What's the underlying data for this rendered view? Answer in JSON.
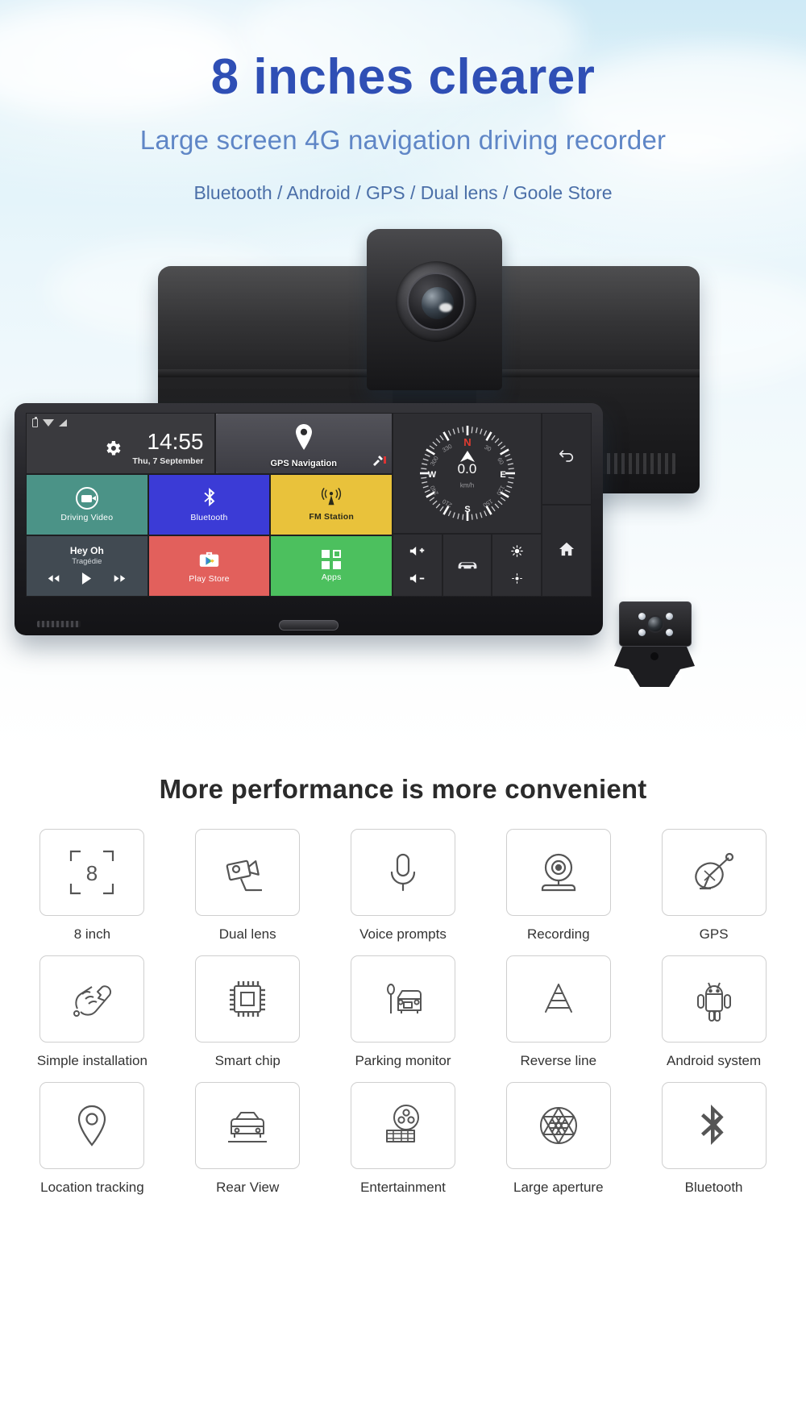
{
  "hero": {
    "title": "8 inches clearer",
    "subtitle": "Large screen 4G navigation driving recorder",
    "features_line": "Bluetooth / Android / GPS / Dual lens / Goole Store"
  },
  "device_screen": {
    "status_bar": {
      "battery_icon": "battery-icon",
      "wifi_icon": "wifi-icon",
      "signal_icon": "signal-icon"
    },
    "clock": {
      "time": "14:55",
      "date": "Thu, 7 September"
    },
    "settings_icon": "gear-icon",
    "map_tile": {
      "label": "GPS Navigation",
      "pin_icon": "map-pin-icon",
      "satellite_icon": "satellite-icon"
    },
    "tiles": [
      {
        "label": "Driving Video",
        "icon": "video-camera-icon",
        "color": "#4b9387"
      },
      {
        "label": "Bluetooth",
        "icon": "bluetooth-icon",
        "color": "#3b3bd6"
      },
      {
        "label": "FM Station",
        "icon": "radio-tower-icon",
        "color": "#e9c23b"
      },
      {
        "label": "Play Store",
        "icon": "play-store-icon",
        "color": "#e2605c"
      },
      {
        "label": "Apps",
        "icon": "apps-grid-icon",
        "color": "#4cc05e"
      }
    ],
    "music_player": {
      "track_title": "Hey Oh",
      "artist": "Tragédie",
      "prev_icon": "previous-track-icon",
      "play_icon": "play-icon",
      "next_icon": "next-track-icon"
    },
    "compass": {
      "north": "N",
      "east": "E",
      "south": "S",
      "west": "W",
      "ticks": [
        "30",
        "60",
        "120",
        "150",
        "210",
        "240",
        "300",
        "330"
      ],
      "speed_value": "0.0",
      "speed_unit": "km/h",
      "needle_icon": "compass-needle-icon"
    },
    "controls": [
      {
        "name": "volume-up",
        "icon": "volume-up-icon"
      },
      {
        "name": "volume-down",
        "icon": "volume-down-icon"
      },
      {
        "name": "car-mode",
        "icon": "car-icon"
      },
      {
        "name": "brightness-up",
        "icon": "brightness-up-icon"
      },
      {
        "name": "brightness-down",
        "icon": "brightness-down-icon"
      }
    ],
    "nav_buttons": [
      {
        "name": "back",
        "icon": "back-arrow-icon"
      },
      {
        "name": "home",
        "icon": "home-icon"
      }
    ]
  },
  "features_section": {
    "title": "More performance is more convenient",
    "items": [
      {
        "label": "8 inch",
        "icon": "screen-size-8-icon"
      },
      {
        "label": "Dual lens",
        "icon": "dual-lens-camera-icon"
      },
      {
        "label": "Voice prompts",
        "icon": "microphone-icon"
      },
      {
        "label": "Recording",
        "icon": "webcam-recording-icon"
      },
      {
        "label": "GPS",
        "icon": "satellite-dish-icon"
      },
      {
        "label": "Simple installation",
        "icon": "hand-wrench-icon"
      },
      {
        "label": "Smart chip",
        "icon": "cpu-chip-icon"
      },
      {
        "label": "Parking monitor",
        "icon": "parking-car-icon"
      },
      {
        "label": "Reverse line",
        "icon": "reverse-guideline-icon"
      },
      {
        "label": "Android system",
        "icon": "android-robot-icon"
      },
      {
        "label": "Location tracking",
        "icon": "location-pin-icon"
      },
      {
        "label": "Rear View",
        "icon": "rear-view-car-icon"
      },
      {
        "label": "Entertainment",
        "icon": "film-reel-icon"
      },
      {
        "label": "Large aperture",
        "icon": "aperture-icon"
      },
      {
        "label": "Bluetooth",
        "icon": "bluetooth-icon"
      }
    ]
  }
}
